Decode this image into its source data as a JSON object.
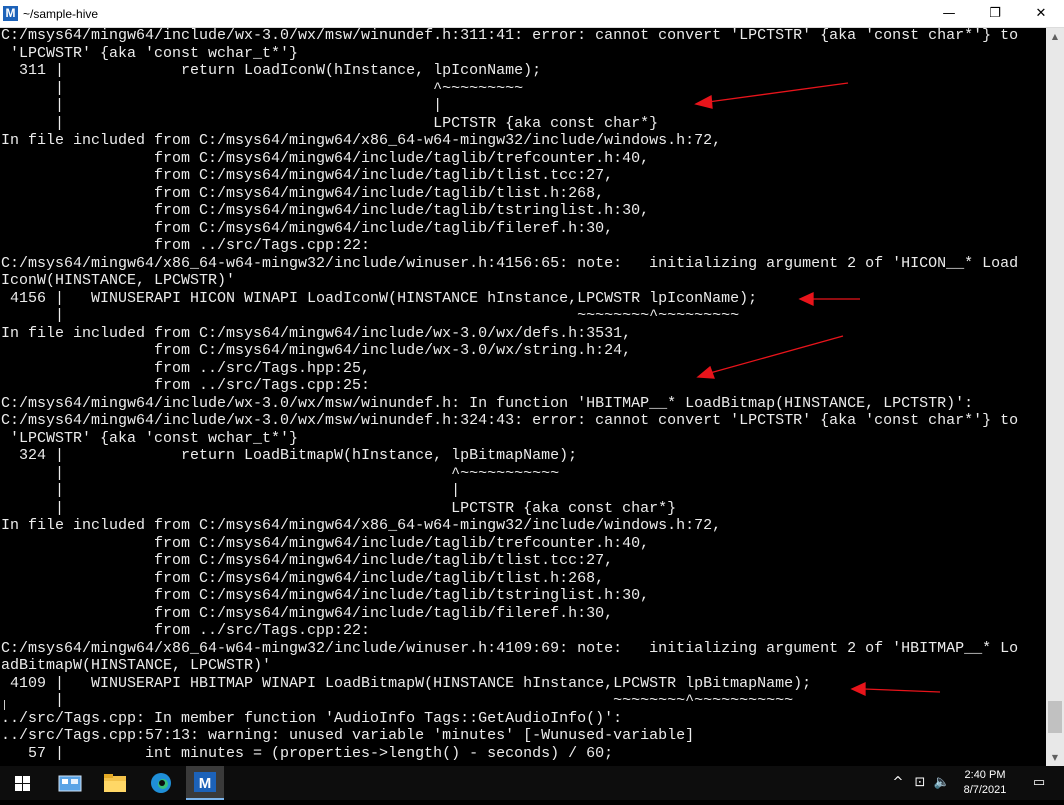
{
  "window": {
    "title": "~/sample-hive",
    "minimize": "—",
    "restore": "❐",
    "close": "✕"
  },
  "terminal": {
    "lines": [
      "C:/msys64/mingw64/include/wx-3.0/wx/msw/winundef.h:311:41: error: cannot convert 'LPCTSTR' {aka 'const char*'} to",
      " 'LPCWSTR' {aka 'const wchar_t*'}",
      "  311 |             return LoadIconW(hInstance, lpIconName);",
      "      |                                         ^~~~~~~~~~",
      "      |                                         |",
      "      |                                         LPCTSTR {aka const char*}",
      "In file included from C:/msys64/mingw64/x86_64-w64-mingw32/include/windows.h:72,",
      "                 from C:/msys64/mingw64/include/taglib/trefcounter.h:40,",
      "                 from C:/msys64/mingw64/include/taglib/tlist.tcc:27,",
      "                 from C:/msys64/mingw64/include/taglib/tlist.h:268,",
      "                 from C:/msys64/mingw64/include/taglib/tstringlist.h:30,",
      "                 from C:/msys64/mingw64/include/taglib/fileref.h:30,",
      "                 from ../src/Tags.cpp:22:",
      "C:/msys64/mingw64/x86_64-w64-mingw32/include/winuser.h:4156:65: note:   initializing argument 2 of 'HICON__* Load",
      "IconW(HINSTANCE, LPCWSTR)'",
      " 4156 |   WINUSERAPI HICON WINAPI LoadIconW(HINSTANCE hInstance,LPCWSTR lpIconName);",
      "      |                                                         ~~~~~~~~^~~~~~~~~~",
      "In file included from C:/msys64/mingw64/include/wx-3.0/wx/defs.h:3531,",
      "                 from C:/msys64/mingw64/include/wx-3.0/wx/string.h:24,",
      "                 from ../src/Tags.hpp:25,",
      "                 from ../src/Tags.cpp:25:",
      "C:/msys64/mingw64/include/wx-3.0/wx/msw/winundef.h: In function 'HBITMAP__* LoadBitmap(HINSTANCE, LPCTSTR)':",
      "C:/msys64/mingw64/include/wx-3.0/wx/msw/winundef.h:324:43: error: cannot convert 'LPCTSTR' {aka 'const char*'} to",
      " 'LPCWSTR' {aka 'const wchar_t*'}",
      "  324 |             return LoadBitmapW(hInstance, lpBitmapName);",
      "      |                                           ^~~~~~~~~~~~",
      "      |                                           |",
      "      |                                           LPCTSTR {aka const char*}",
      "In file included from C:/msys64/mingw64/x86_64-w64-mingw32/include/windows.h:72,",
      "                 from C:/msys64/mingw64/include/taglib/trefcounter.h:40,",
      "                 from C:/msys64/mingw64/include/taglib/tlist.tcc:27,",
      "                 from C:/msys64/mingw64/include/taglib/tlist.h:268,",
      "                 from C:/msys64/mingw64/include/taglib/tstringlist.h:30,",
      "                 from C:/msys64/mingw64/include/taglib/fileref.h:30,",
      "                 from ../src/Tags.cpp:22:",
      "C:/msys64/mingw64/x86_64-w64-mingw32/include/winuser.h:4109:69: note:   initializing argument 2 of 'HBITMAP__* Lo",
      "adBitmapW(HINSTANCE, LPCWSTR)'",
      " 4109 |   WINUSERAPI HBITMAP WINAPI LoadBitmapW(HINSTANCE hInstance,LPCWSTR lpBitmapName);",
      "      |                                                             ~~~~~~~~^~~~~~~~~~~~",
      "../src/Tags.cpp: In member function 'AudioInfo Tags::GetAudioInfo()':",
      "../src/Tags.cpp:57:13: warning: unused variable 'minutes' [-Wunused-variable]",
      "   57 |         int minutes = (properties->length() - seconds) / 60;"
    ]
  },
  "annotation_color": "#e8141b",
  "taskbar": {
    "clock_time": "2:40 PM",
    "clock_date": "8/7/2021"
  }
}
